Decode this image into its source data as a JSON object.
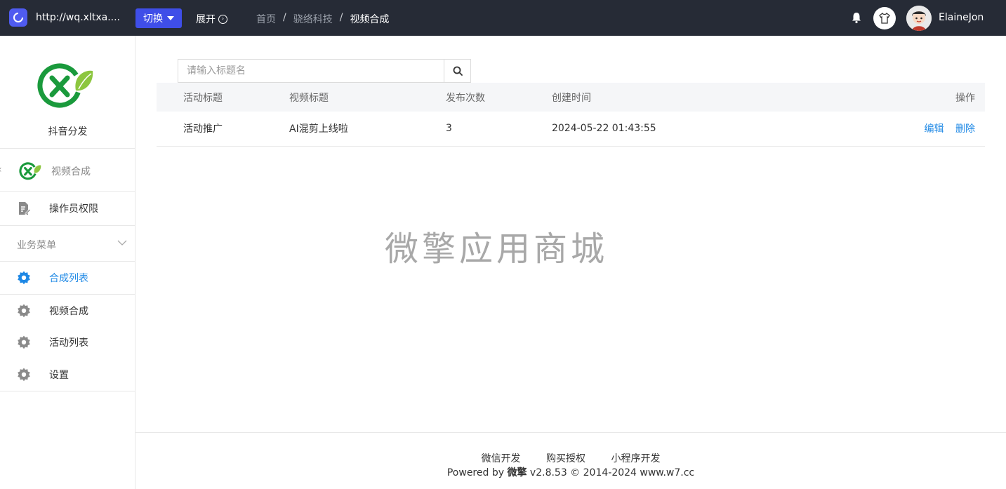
{
  "topbar": {
    "url": "http://wq.xltxa....",
    "switch_label": "切换",
    "expand_label": "展开",
    "username": "ElaineJon"
  },
  "breadcrumb": [
    "首页",
    "骁络科技",
    "视频合成"
  ],
  "sidebar": {
    "brand_name": "抖音分发",
    "module_name": "视频合成",
    "permission_label": "操作员权限",
    "section_label": "业务菜单",
    "items": [
      {
        "label": "合成列表",
        "active": true
      },
      {
        "label": "视频合成",
        "active": false
      },
      {
        "label": "活动列表",
        "active": false
      },
      {
        "label": "设置",
        "active": false
      }
    ]
  },
  "search": {
    "placeholder": "请输入标题名"
  },
  "table": {
    "headers": [
      "活动标题",
      "视频标题",
      "发布次数",
      "创建时间",
      "操作"
    ],
    "rows": [
      {
        "activity_title": "活动推广",
        "video_title": "AI混剪上线啦",
        "publish_count": "3",
        "created_at": "2024-05-22 01:43:55",
        "edit": "编辑",
        "delete": "删除"
      }
    ]
  },
  "watermark": "微擎应用商城",
  "footer": {
    "links": [
      "微信开发",
      "购买授权",
      "小程序开发"
    ],
    "powered_prefix": "Powered by",
    "powered_brand": "微擎",
    "powered_suffix": "v2.8.53 © 2014-2024 www.w7.cc"
  },
  "colors": {
    "accent": "#1e88e5",
    "topbar": "#262b36",
    "switch": "#3f4ee8"
  }
}
